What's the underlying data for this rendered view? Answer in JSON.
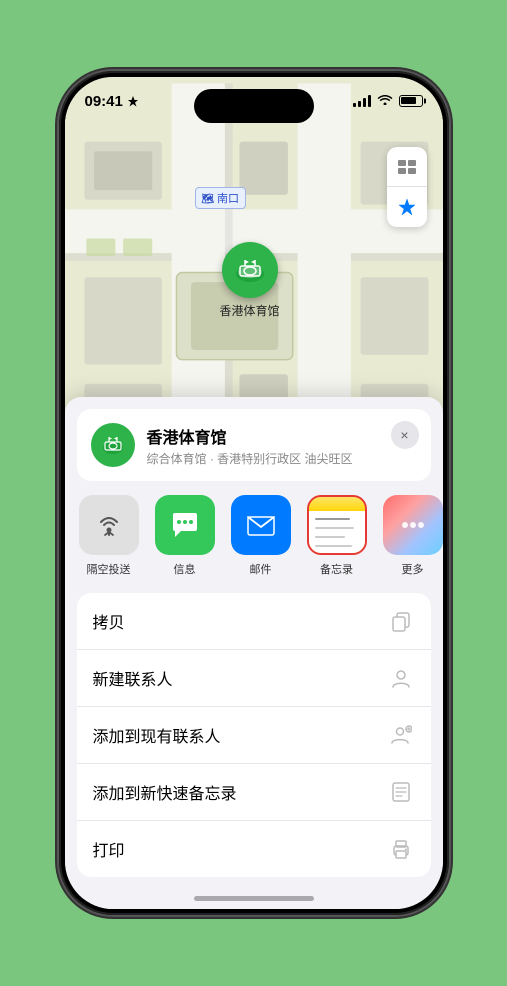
{
  "status_bar": {
    "time": "09:41",
    "location_arrow": "▶"
  },
  "map": {
    "label": "南口",
    "stadium_name": "香港体育馆",
    "controls": {
      "map_type": "🗺",
      "location": "➤"
    }
  },
  "venue_card": {
    "name": "香港体育馆",
    "subtitle": "综合体育馆 · 香港特别行政区 油尖旺区",
    "close_label": "×"
  },
  "share_items": [
    {
      "label": "隔空投送",
      "type": "airdrop"
    },
    {
      "label": "信息",
      "type": "messages"
    },
    {
      "label": "邮件",
      "type": "mail"
    },
    {
      "label": "备忘录",
      "type": "notes"
    },
    {
      "label": "更多",
      "type": "more"
    }
  ],
  "action_rows": [
    {
      "label": "拷贝",
      "icon": "copy"
    },
    {
      "label": "新建联系人",
      "icon": "person"
    },
    {
      "label": "添加到现有联系人",
      "icon": "person-add"
    },
    {
      "label": "添加到新快速备忘录",
      "icon": "memo"
    },
    {
      "label": "打印",
      "icon": "print"
    }
  ]
}
